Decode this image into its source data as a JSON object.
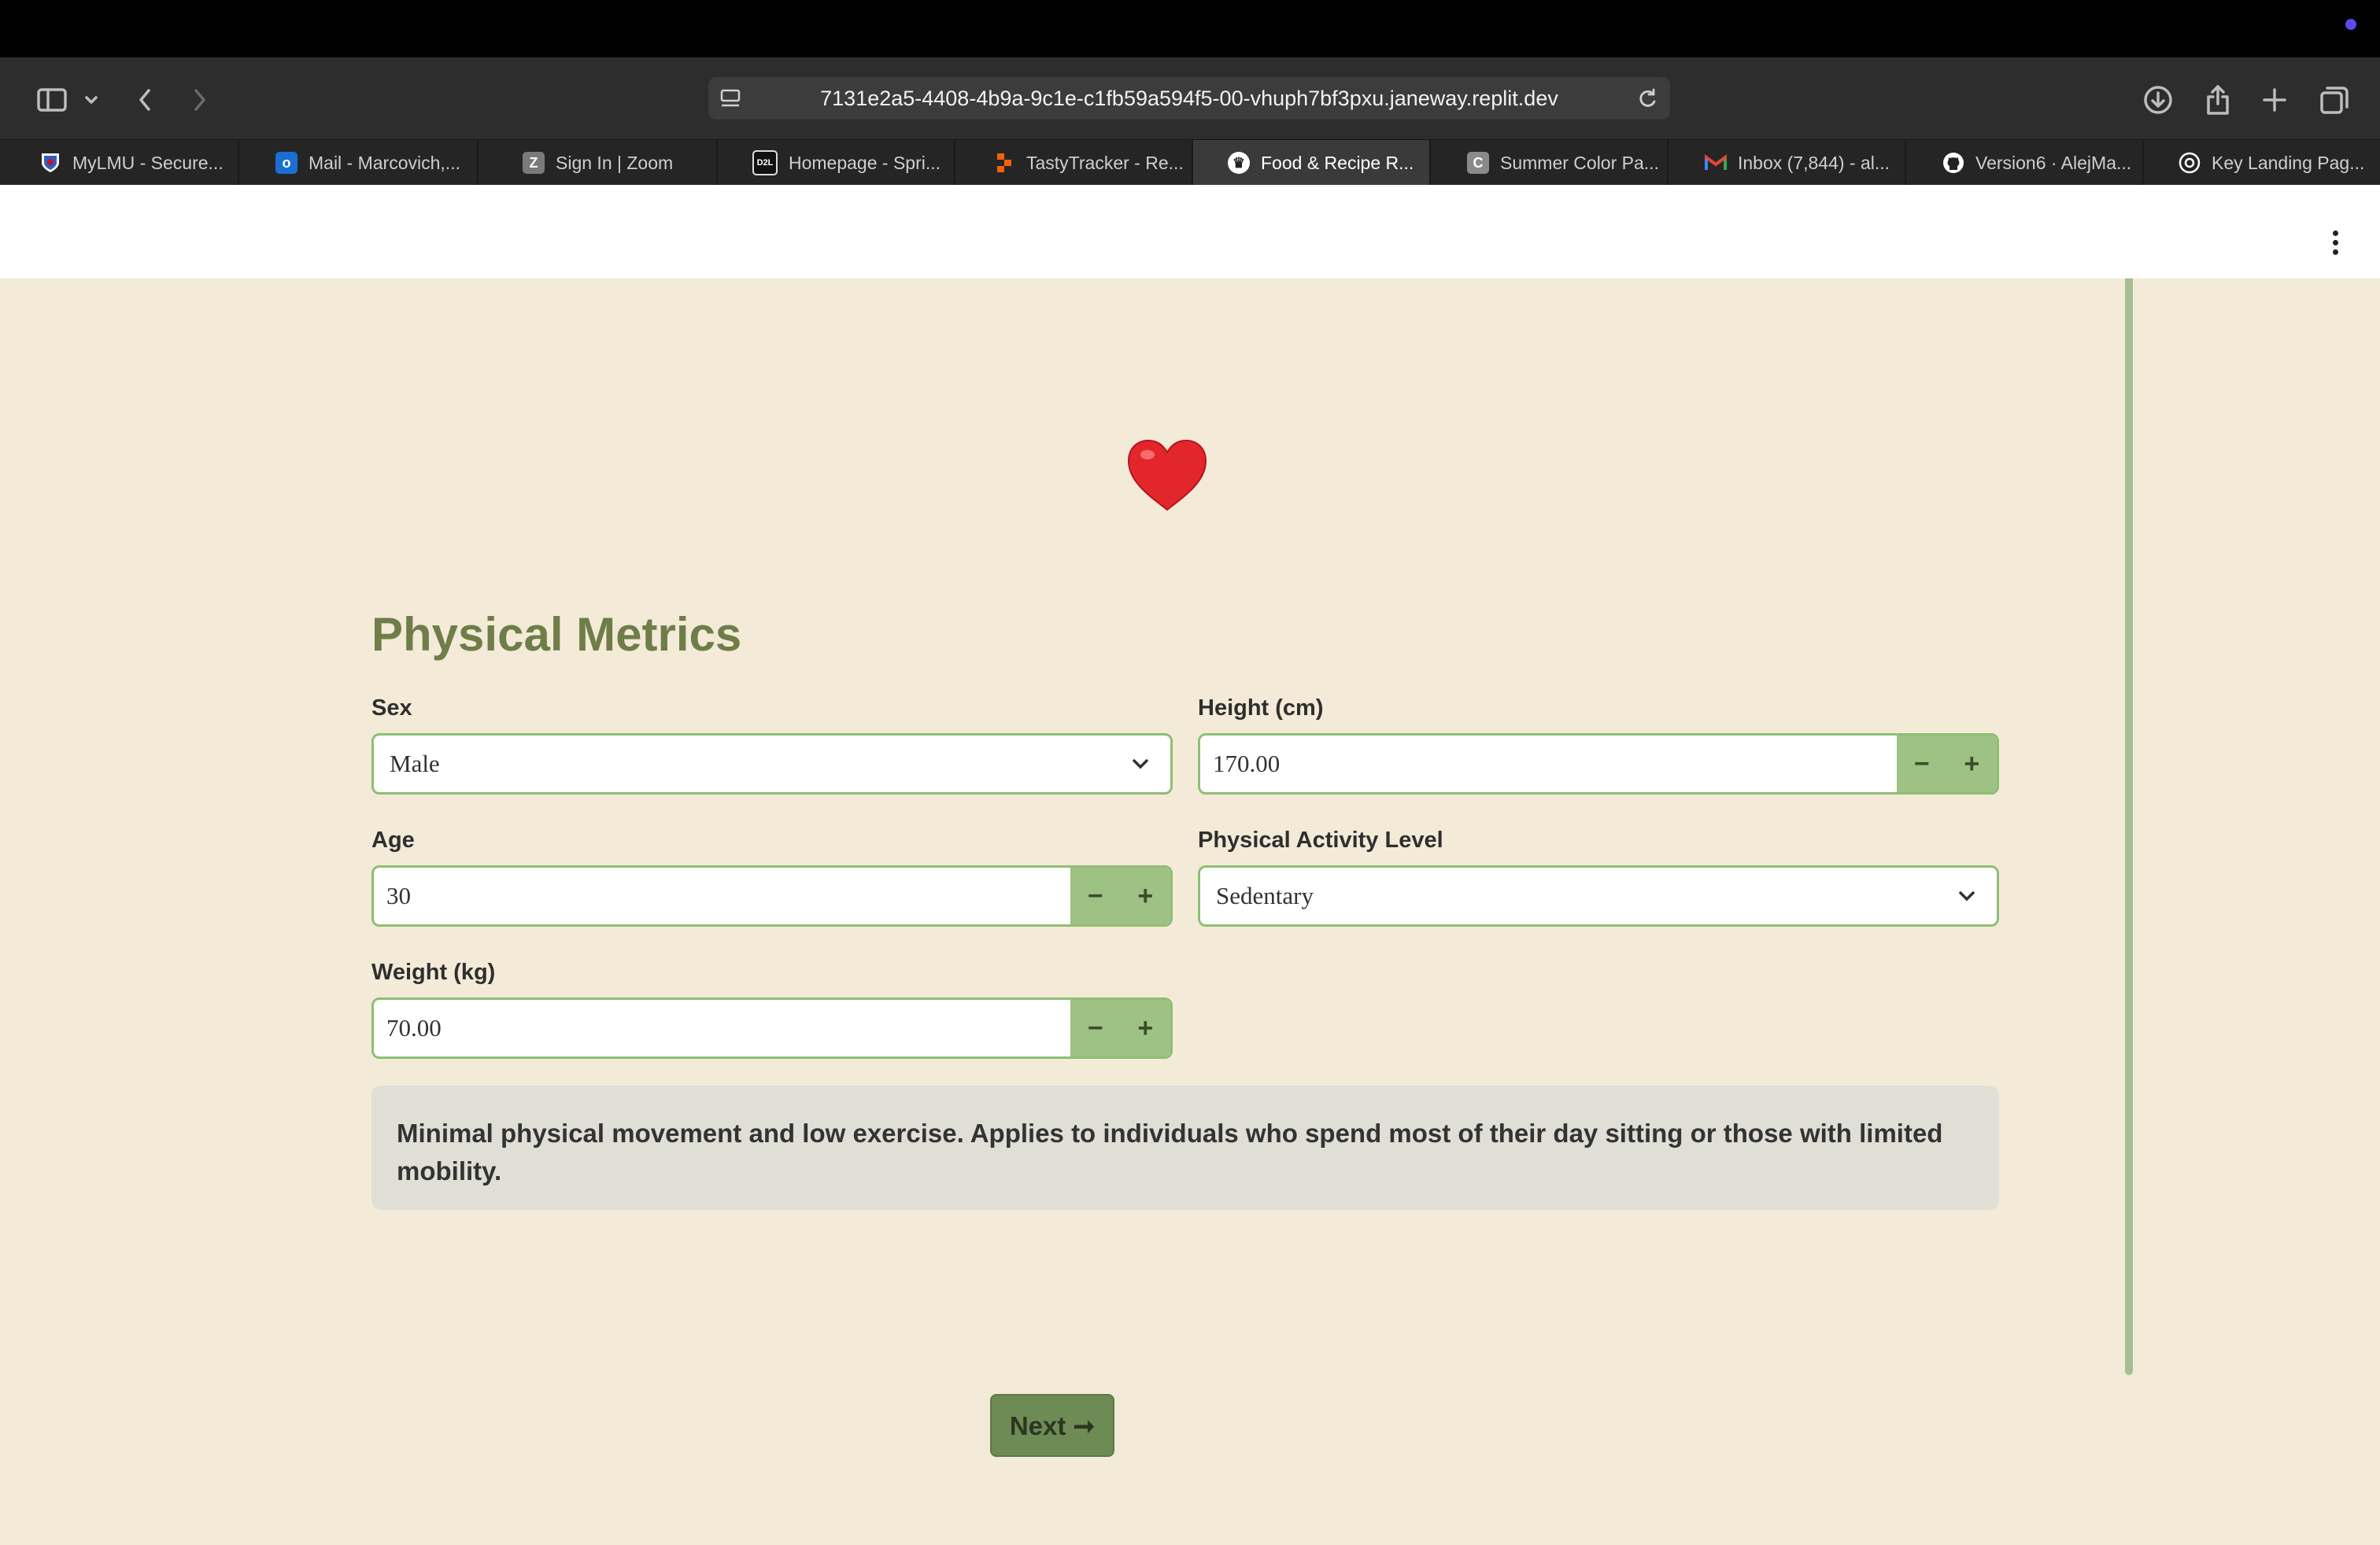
{
  "browser": {
    "url": "7131e2a5-4408-4b9a-9c1e-c1fb59a594f5-00-vhuph7bf3pxu.janeway.replit.dev",
    "tabs": [
      {
        "label": "MyLMU - Secure...",
        "icon": "lmu-shield-icon",
        "fav_text": "",
        "fav_color": "#2d5ec4"
      },
      {
        "label": "Mail - Marcovich,...",
        "icon": "outlook-icon",
        "fav_text": "o",
        "fav_color": "#1a6fd0"
      },
      {
        "label": "Sign In | Zoom",
        "icon": "zoom-icon",
        "fav_text": "Z",
        "fav_color": "#7a7a7a"
      },
      {
        "label": "Homepage - Spri...",
        "icon": "d2l-icon",
        "fav_text": "D2L",
        "fav_color": "#111111"
      },
      {
        "label": "TastyTracker - Re...",
        "icon": "replit-icon",
        "fav_text": "",
        "fav_color": "#f26207"
      },
      {
        "label": "Food & Recipe R...",
        "icon": "crown-icon",
        "fav_text": "♛",
        "fav_color": "#ffffff"
      },
      {
        "label": "Summer Color Pa...",
        "icon": "coolors-icon",
        "fav_text": "C",
        "fav_color": "#8a8a8a"
      },
      {
        "label": "Inbox (7,844) - al...",
        "icon": "gmail-icon",
        "fav_text": "M",
        "fav_color": "#2d2d2d"
      },
      {
        "label": "Version6 · AlejMa...",
        "icon": "github-icon",
        "fav_text": "",
        "fav_color": "#ffffff"
      },
      {
        "label": "Key Landing Pag...",
        "icon": "openai-icon",
        "fav_text": "",
        "fav_color": "#ffffff"
      }
    ]
  },
  "form": {
    "header_icon": "heart-icon",
    "title": "Physical Metrics",
    "sex": {
      "label": "Sex",
      "value": "Male"
    },
    "height": {
      "label": "Height (cm)",
      "value": "170.00"
    },
    "age": {
      "label": "Age",
      "value": "30"
    },
    "activity": {
      "label": "Physical Activity Level",
      "value": "Sedentary"
    },
    "weight": {
      "label": "Weight (kg)",
      "value": "70.00"
    },
    "stepper": {
      "minus": "−",
      "plus": "+"
    },
    "description": "Minimal physical movement and low exercise. Applies to individuals who spend most of their day sitting or those with limited mobility.",
    "next_label": "Next ➞"
  },
  "colors": {
    "page_bg": "#f3ead8",
    "accent": "#6e8b55",
    "field_border": "#8fbf74",
    "title": "#6f7d49"
  }
}
